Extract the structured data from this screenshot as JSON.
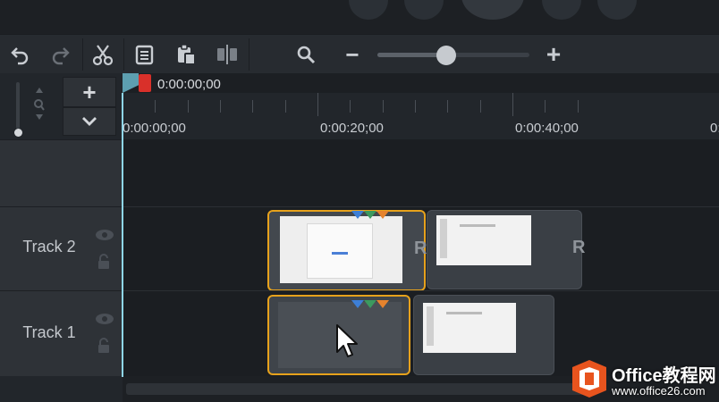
{
  "toolbar": {
    "undo_icon": "undo-icon",
    "redo_icon": "redo-icon",
    "cut_icon": "scissors-icon",
    "copy_icon": "copy-icon",
    "paste_icon": "paste-icon",
    "split_icon": "split-icon",
    "search_icon": "search-icon",
    "zoom_out_label": "−",
    "zoom_in_label": "+",
    "zoom_level": 0.45
  },
  "timeline": {
    "playhead_time": "0:00:00;00",
    "ruler_labels": [
      "0:00:00;00",
      "0:00:20;00",
      "0:00:40;00",
      "0:"
    ],
    "add_track_label": "+",
    "expand_label": "⌄"
  },
  "tracks": [
    {
      "name": "Track 2"
    },
    {
      "name": "Track 1"
    }
  ],
  "clip_edge_letter": "R",
  "watermark": {
    "brand": "Office教程网",
    "url": "www.office26.com"
  },
  "colors": {
    "selection": "#e7a21c",
    "playhead": "#8fd6e8",
    "marker_blue": "#3d7fd6",
    "marker_green": "#3c9a5f",
    "marker_orange": "#e5832d",
    "watermark_orange": "#e8541e"
  }
}
